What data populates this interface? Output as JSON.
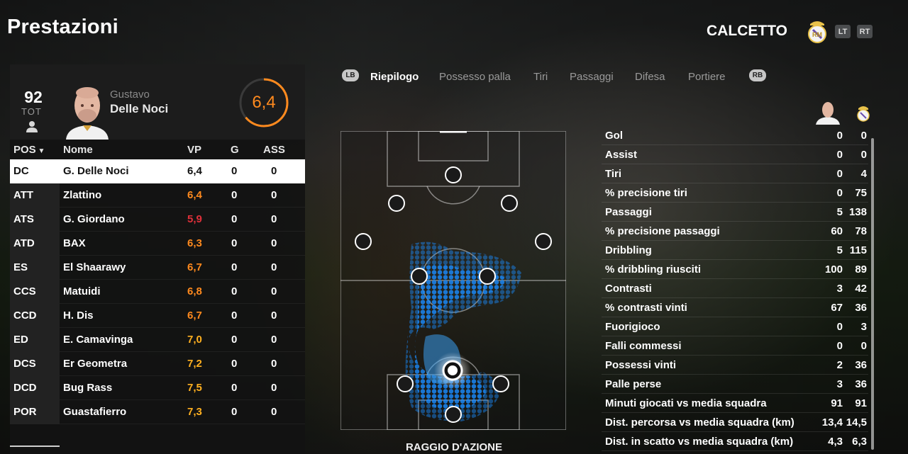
{
  "header": {
    "title": "Prestazioni",
    "mode": "CALCETTO",
    "lt_label": "LT",
    "rt_label": "RT"
  },
  "player": {
    "overall": "92",
    "overall_label": "TOT",
    "first_name": "Gustavo",
    "last_name": "Delle Noci",
    "rating": "6,4",
    "rating_fraction": 0.64,
    "rating_color": "#ff8a1e"
  },
  "table": {
    "headers": {
      "pos": "POS",
      "name": "Nome",
      "vp": "VP",
      "g": "G",
      "ass": "ASS"
    },
    "rows": [
      {
        "pos": "DC",
        "name": "G. Delle Noci",
        "vp": "6,4",
        "g": "0",
        "ass": "0",
        "vp_color": "#111111",
        "selected": true
      },
      {
        "pos": "ATT",
        "name": "Zlattino",
        "vp": "6,4",
        "g": "0",
        "ass": "0",
        "vp_color": "#ff8a1e"
      },
      {
        "pos": "ATS",
        "name": "G. Giordano",
        "vp": "5,9",
        "g": "0",
        "ass": "0",
        "vp_color": "#e0303a"
      },
      {
        "pos": "ATD",
        "name": "BAX",
        "vp": "6,3",
        "g": "0",
        "ass": "0",
        "vp_color": "#ff8a1e"
      },
      {
        "pos": "ES",
        "name": "El Shaarawy",
        "vp": "6,7",
        "g": "0",
        "ass": "0",
        "vp_color": "#ff8a1e"
      },
      {
        "pos": "CCS",
        "name": "Matuidi",
        "vp": "6,8",
        "g": "0",
        "ass": "0",
        "vp_color": "#ff8a1e"
      },
      {
        "pos": "CCD",
        "name": "H. Dis",
        "vp": "6,7",
        "g": "0",
        "ass": "0",
        "vp_color": "#ff8a1e"
      },
      {
        "pos": "ED",
        "name": "E. Camavinga",
        "vp": "7,0",
        "g": "0",
        "ass": "0",
        "vp_color": "#ffb020"
      },
      {
        "pos": "DCS",
        "name": "Er Geometra",
        "vp": "7,2",
        "g": "0",
        "ass": "0",
        "vp_color": "#ffb020"
      },
      {
        "pos": "DCD",
        "name": "Bug Rass",
        "vp": "7,5",
        "g": "0",
        "ass": "0",
        "vp_color": "#ffb020"
      },
      {
        "pos": "POR",
        "name": "Guastafierro",
        "vp": "7,3",
        "g": "0",
        "ass": "0",
        "vp_color": "#ffb020"
      }
    ]
  },
  "tabs": {
    "lb_label": "LB",
    "rb_label": "RB",
    "items": [
      "Riepilogo",
      "Possesso palla",
      "Tiri",
      "Passaggi",
      "Difesa",
      "Portiere"
    ],
    "active": 0
  },
  "pitch": {
    "title": "RAGGIO D'AZIONE",
    "heat_color": "#1a8cff"
  },
  "stats": [
    {
      "label": "Gol",
      "player": "0",
      "team": "0"
    },
    {
      "label": "Assist",
      "player": "0",
      "team": "0"
    },
    {
      "label": "Tiri",
      "player": "0",
      "team": "4"
    },
    {
      "label": "% precisione tiri",
      "player": "0",
      "team": "75"
    },
    {
      "label": "Passaggi",
      "player": "5",
      "team": "138"
    },
    {
      "label": "% precisione passaggi",
      "player": "60",
      "team": "78"
    },
    {
      "label": "Dribbling",
      "player": "5",
      "team": "115"
    },
    {
      "label": "% dribbling riusciti",
      "player": "100",
      "team": "89"
    },
    {
      "label": "Contrasti",
      "player": "3",
      "team": "42"
    },
    {
      "label": "% contrasti vinti",
      "player": "67",
      "team": "36"
    },
    {
      "label": "Fuorigioco",
      "player": "0",
      "team": "3"
    },
    {
      "label": "Falli commessi",
      "player": "0",
      "team": "0"
    },
    {
      "label": "Possessi vinti",
      "player": "2",
      "team": "36"
    },
    {
      "label": "Palle perse",
      "player": "3",
      "team": "36"
    },
    {
      "label": "Minuti giocati vs media squadra",
      "player": "91",
      "team": "91"
    },
    {
      "label": "Dist. percorsa vs media squadra (km)",
      "player": "13,4",
      "team": "14,5"
    },
    {
      "label": "Dist. in scatto vs media squadra (km)",
      "player": "4,3",
      "team": "6,3"
    }
  ]
}
